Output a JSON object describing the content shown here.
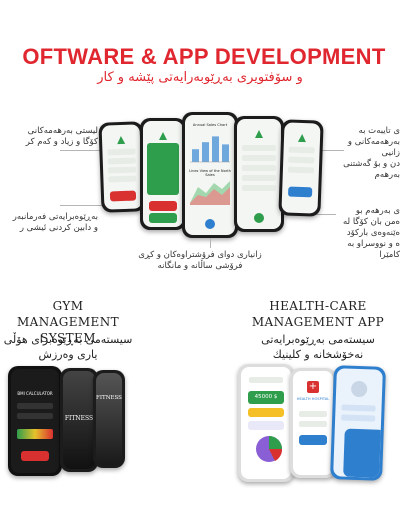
{
  "header": {
    "title": "OFTWARE & APP DEVELOPMENT",
    "subtitle": "و سۆفتویری بەڕێوبەرایەتی پێشە و کار"
  },
  "notes": {
    "top_left": [
      "لیستی بەرهەمەکانی",
      "کۆگا و زیاد و کەم کر"
    ],
    "mid_left": [
      "بەڕێوەبرایەتی فەرمانبەر",
      "و دابین کردنی ئیشی ر"
    ],
    "top_right": [
      "ی تایبەت بە",
      "بەرهەمەکانی و زانیی",
      "دن و بۆ گەشتنی",
      "بەرهەم"
    ],
    "mid_right": [
      "ی بەرهەم بو",
      "ەمن بان کۆگا لە",
      "ەێنەوەی بارکۆد",
      "ە و نووسراو بە",
      "کامێرا"
    ],
    "bottom_center": [
      "زانیاری دوای فرۆشتراوەکان و کڕی",
      "فرۆشی ساڵانە و مانگانە"
    ]
  },
  "phone_chart": {
    "title1": "Annual Sales Chart",
    "title2": "Lines View of the North Sales",
    "bar_values": [
      40,
      62,
      80,
      55
    ]
  },
  "gym": {
    "title_line1": "GYM MANAGEMENT",
    "title_line2": "SYSTEM",
    "subtitle_line1": "سیستەمی بەڕێوەبرای هۆڵی",
    "subtitle_line2": "یاری وەرزش",
    "screen1_label": "BMI CALCULATOR",
    "screen2_label": "FITNESS",
    "screen3_label": "FITNESS"
  },
  "health": {
    "title_line1": "HEALTH-CARE",
    "title_line2": "MANAGEMENT APP",
    "subtitle_line1": "سیستەمی بەڕێوەبرایەتی",
    "subtitle_line2": "نەخۆشخانە و کلینیك",
    "amount": "45000 $",
    "app_name": "HEALTH HOSPITAL"
  },
  "colors": {
    "accent": "#e0262e",
    "green": "#2e9d4c",
    "red": "#d93030",
    "blue": "#2f7fcf"
  }
}
